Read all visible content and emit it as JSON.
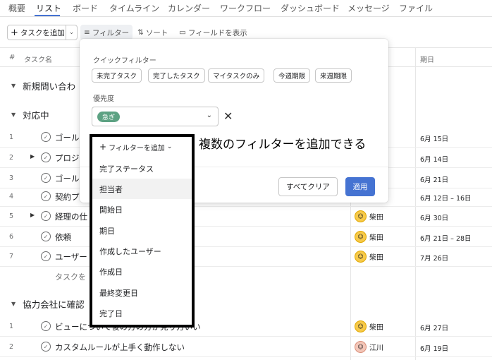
{
  "nav": {
    "tabs": [
      "概要",
      "リスト",
      "ボード",
      "タイムライン",
      "カレンダー",
      "ワークフロー",
      "ダッシュボード",
      "メッセージ",
      "ファイル"
    ],
    "active_index": 1
  },
  "toolbar": {
    "add_task": "タスクを追加",
    "filter": "フィルター",
    "sort": "ソート",
    "show_fields": "フィールドを表示"
  },
  "table": {
    "col_num": "#",
    "col_name": "タスク名",
    "col_due": "期日"
  },
  "sections": [
    {
      "title": "新規問い合わ"
    },
    {
      "title": "対応中"
    },
    {
      "title": "協力会社に確認"
    }
  ],
  "rows": [
    {
      "num": "1",
      "name": "ゴール",
      "assignee": "",
      "date": "6月 15日",
      "expand": false
    },
    {
      "num": "2",
      "name": "プロジ",
      "assignee": "",
      "date": "6月 14日",
      "expand": true
    },
    {
      "num": "3",
      "name": "ゴール",
      "assignee": "",
      "date": "6月 21日",
      "expand": false
    },
    {
      "num": "4",
      "name": "契約プ",
      "assignee": "",
      "date": "6月 12日 – 16日",
      "expand": false
    },
    {
      "num": "5",
      "name": "経理の仕",
      "assignee": "柴田",
      "date": "6月 30日",
      "expand": true
    },
    {
      "num": "6",
      "name": "依頼",
      "assignee": "柴田",
      "date": "6月 21日 – 28日",
      "expand": false
    },
    {
      "num": "7",
      "name": "ユーザー",
      "assignee": "柴田",
      "date": "7月 26日",
      "expand": false
    }
  ],
  "add_task_row": "タスクを",
  "rows2": [
    {
      "num": "1",
      "name": "ビューについて後の方の方が見り方いい",
      "assignee": "柴田",
      "date": "6月 27日"
    },
    {
      "num": "2",
      "name": "カスタムルールが上手く動作しない",
      "assignee": "江川",
      "date": "6月 19日"
    }
  ],
  "filter_panel": {
    "quick_label": "クイックフィルター",
    "quick_chips": [
      "未完了タスク",
      "完了したタスク",
      "マイタスクのみ",
      "今週期限",
      "来週期限"
    ],
    "priority_label": "優先度",
    "priority_value": "急ぎ",
    "clear_all": "すべてクリア",
    "apply": "適用",
    "priority_color": "#5da283",
    "apply_color": "#4573d2"
  },
  "add_filter": {
    "label": "フィルターを追加",
    "options": [
      "完了ステータス",
      "担当者",
      "開始日",
      "期日",
      "作成したユーザー",
      "作成日",
      "最終変更日",
      "完了日"
    ],
    "hover_index": 1
  },
  "annotation": "複数のフィルターを追加できる"
}
